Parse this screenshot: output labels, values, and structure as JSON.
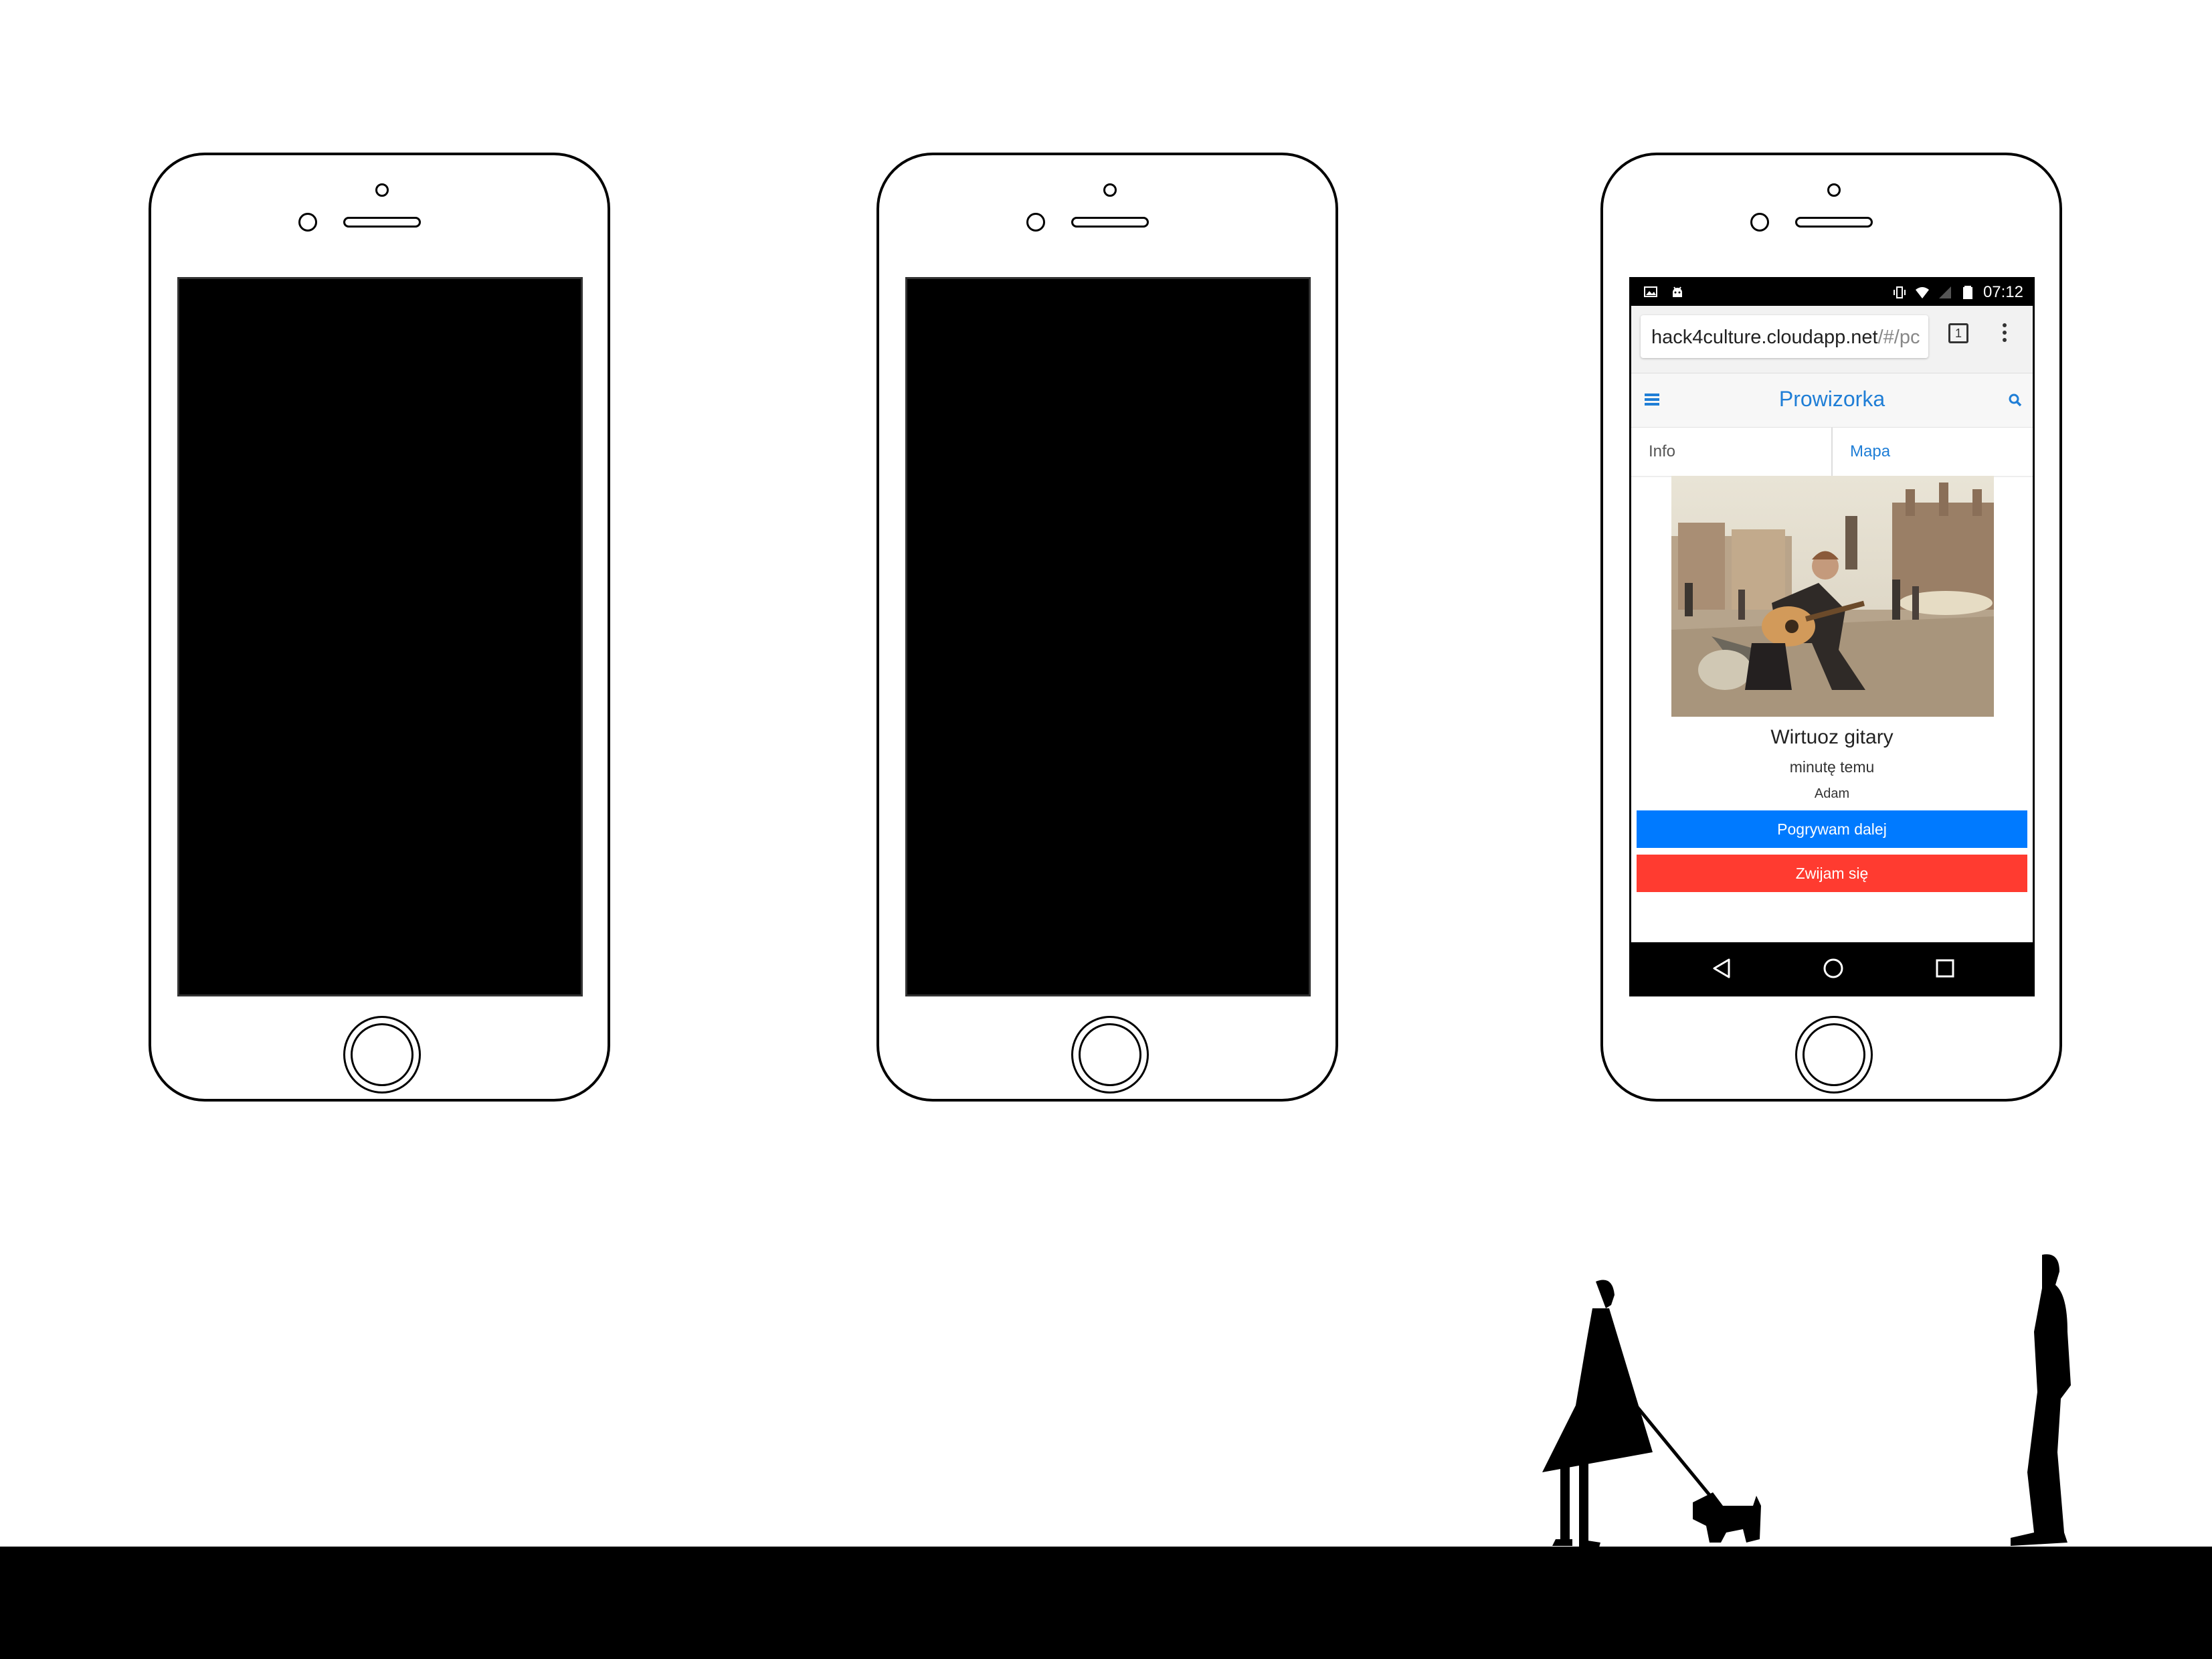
{
  "phones": [
    {
      "id": "left",
      "state": "screen-off"
    },
    {
      "id": "middle",
      "state": "screen-off"
    },
    {
      "id": "right",
      "state": "screen-on"
    }
  ],
  "android": {
    "status_bar": {
      "time": "07:12",
      "left_icons": [
        "image-notification-icon",
        "android-notification-icon"
      ],
      "right_icons": [
        "vibrate-icon",
        "wifi-icon",
        "signal-icon",
        "battery-icon"
      ]
    },
    "browser": {
      "url_host": "hack4culture.cloudapp.net",
      "url_path": "/#/pc",
      "tab_count": "1"
    },
    "app": {
      "title": "Prowizorka",
      "tabs": [
        {
          "label": "Info",
          "active": true
        },
        {
          "label": "Mapa",
          "active": false
        }
      ],
      "item": {
        "title": "Wirtuoz gitary",
        "time": "minutę temu",
        "author": "Adam"
      },
      "buttons": {
        "continue": "Pogrywam dalej",
        "leave": "Zwijam się"
      }
    },
    "colors": {
      "accent": "#1f7ed6",
      "primary_button": "#007aff",
      "danger_button": "#ff3b30"
    }
  }
}
